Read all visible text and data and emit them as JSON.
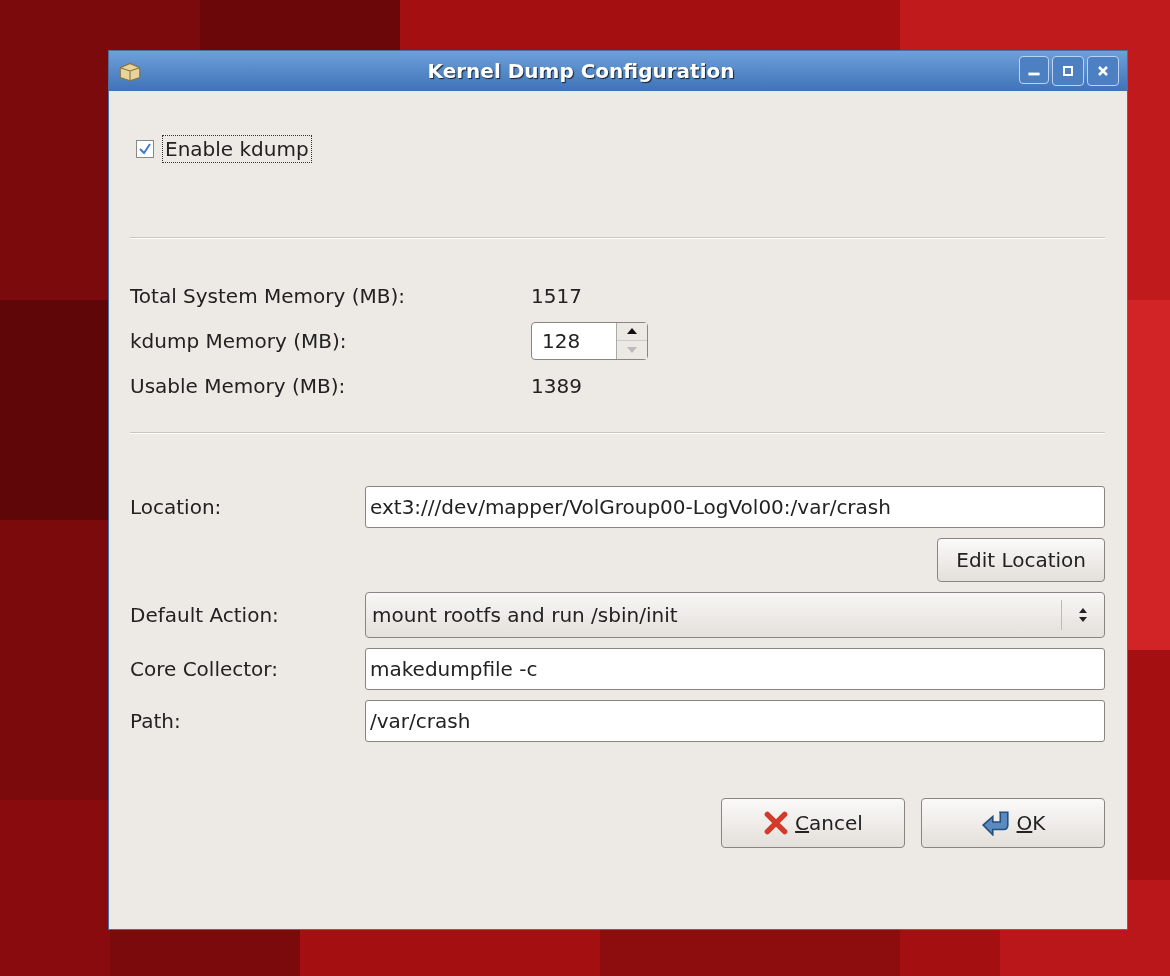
{
  "window": {
    "title": "Kernel Dump Configuration"
  },
  "enable_kdump": {
    "label": "Enable kdump",
    "checked": true
  },
  "memory": [
    {
      "kind": "text",
      "label": "Total System Memory (MB):",
      "value": "1517"
    },
    {
      "kind": "spin",
      "label": "kdump Memory (MB):",
      "value": "128",
      "up_disabled": false,
      "down_disabled": true
    },
    {
      "kind": "text",
      "label": "Usable Memory (MB):",
      "value": "1389"
    }
  ],
  "location": {
    "label": "Location:",
    "value": "ext3:///dev/mapper/VolGroup00-LogVol00:/var/crash"
  },
  "edit_location_button": "Edit Location",
  "settings": [
    {
      "kind": "combo",
      "label": "Default Action:",
      "value": "mount rootfs and run /sbin/init"
    },
    {
      "kind": "entry",
      "label": "Core Collector:",
      "value": "makedumpfile -c"
    },
    {
      "kind": "entry",
      "label": "Path:",
      "value": "/var/crash"
    }
  ],
  "buttons": [
    {
      "kind": "cancel",
      "label": "Cancel"
    },
    {
      "kind": "ok",
      "label": "OK"
    }
  ]
}
